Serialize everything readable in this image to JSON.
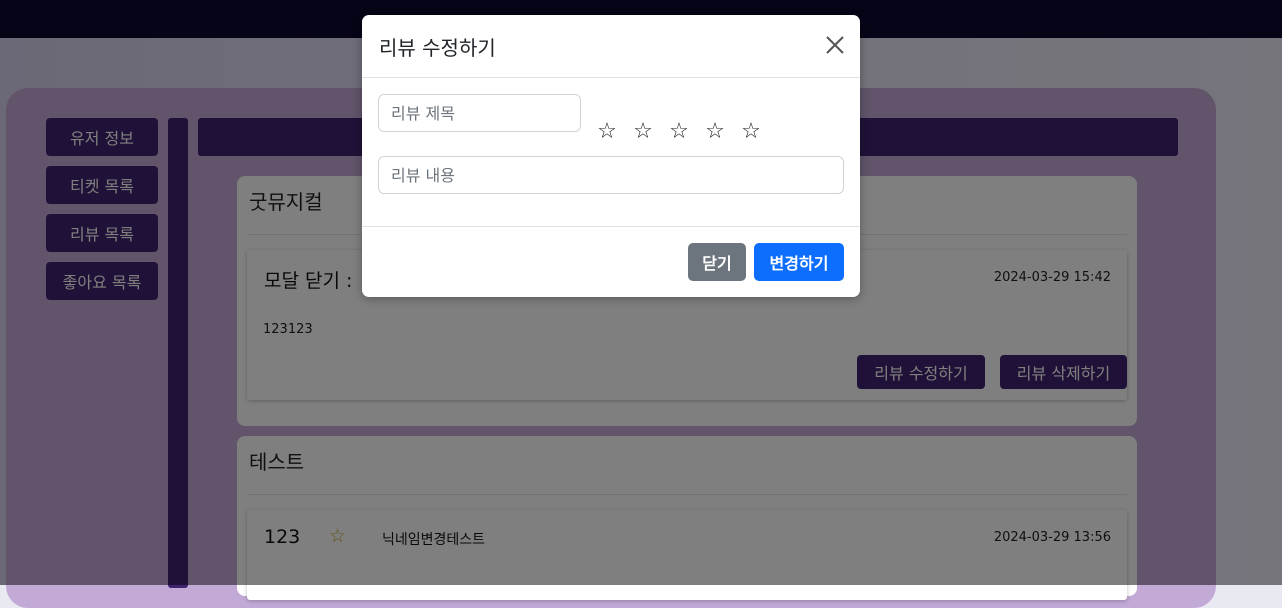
{
  "sidebar": {
    "items": [
      {
        "label": "유저 정보"
      },
      {
        "label": "티켓 목록"
      },
      {
        "label": "리뷰 목록"
      },
      {
        "label": "좋아요 목록"
      }
    ]
  },
  "reviews": [
    {
      "musical": "굿뮤지컬",
      "title": "모달 닫기 :",
      "date": "2024-03-29 15:42",
      "content": "123123",
      "edit_label": "리뷰 수정하기",
      "delete_label": "리뷰 삭제하기"
    },
    {
      "musical": "테스트",
      "title": "123",
      "rating": 1,
      "star_glyph": "☆",
      "nickname": "닉네임변경테스트",
      "date": "2024-03-29 13:56"
    }
  ],
  "modal": {
    "title": "리뷰 수정하기",
    "title_placeholder": "리뷰 제목",
    "content_placeholder": "리뷰 내용",
    "rating_stars": [
      "☆",
      "☆",
      "☆",
      "☆",
      "☆"
    ],
    "close_label": "닫기",
    "save_label": "변경하기"
  },
  "colors": {
    "brand": "#3e236f",
    "topbar": "#0d0b2e",
    "primary": "#0d6efd",
    "secondary": "#6c757d"
  }
}
